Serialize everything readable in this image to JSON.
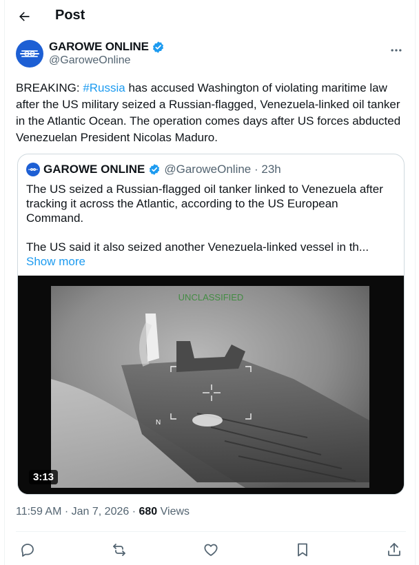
{
  "header": {
    "title": "Post"
  },
  "author": {
    "display_name": "GAROWE ONLINE",
    "handle": "@GaroweOnline"
  },
  "tweet": {
    "prefix": "BREAKING: ",
    "hashtag": "#Russia",
    "body": " has accused Washington of violating maritime law after the US military seized a Russian-flagged, Venezuela-linked oil tanker in the Atlantic Ocean. The operation comes days after US forces abducted Venezuelan President Nicolas Maduro."
  },
  "quote": {
    "display_name": "GAROWE ONLINE",
    "meta": "@GaroweOnline · 23h",
    "para1": "The US seized a Russian-flagged oil tanker linked to Venezuela after tracking it across the Atlantic, according to the US European Command.",
    "para2": "The US said it also seized another Venezuela-linked vessel in th...",
    "show_more": "Show more",
    "video": {
      "duration": "3:13",
      "overlay_text": "UNCLASSIFIED",
      "compass": "N"
    }
  },
  "meta": {
    "time": "11:59 AM · Jan 7, 2026 · ",
    "views_count": "680",
    "views_label": " Views"
  },
  "icons": {
    "back": "arrow-left-icon",
    "verified": "verified-badge-icon",
    "more": "more-dots-icon",
    "reply": "reply-icon",
    "repost": "repost-icon",
    "like": "like-icon",
    "bookmark": "bookmark-icon",
    "share": "share-icon"
  },
  "colors": {
    "accent": "#1d9bf0",
    "text": "#0f1419",
    "muted": "#536471"
  }
}
